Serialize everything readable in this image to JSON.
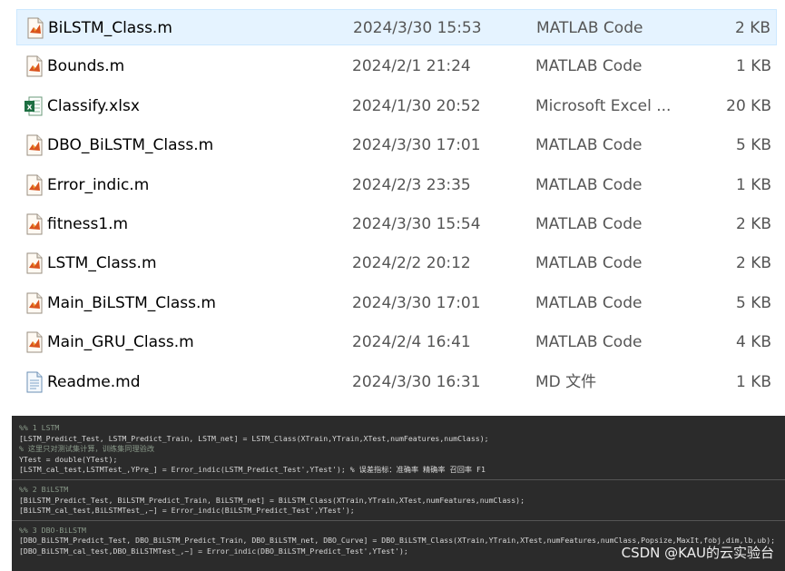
{
  "files": [
    {
      "name": "BiLSTM_Class.m",
      "date": "2024/3/30 15:53",
      "type": "MATLAB Code",
      "size": "2 KB",
      "icon": "matlab-file-icon",
      "selected": true
    },
    {
      "name": "Bounds.m",
      "date": "2024/2/1 21:24",
      "type": "MATLAB Code",
      "size": "1 KB",
      "icon": "matlab-file-icon"
    },
    {
      "name": "Classify.xlsx",
      "date": "2024/1/30 20:52",
      "type": "Microsoft Excel ...",
      "size": "20 KB",
      "icon": "excel-file-icon"
    },
    {
      "name": "DBO_BiLSTM_Class.m",
      "date": "2024/3/30 17:01",
      "type": "MATLAB Code",
      "size": "5 KB",
      "icon": "matlab-file-icon"
    },
    {
      "name": "Error_indic.m",
      "date": "2024/2/3 23:35",
      "type": "MATLAB Code",
      "size": "1 KB",
      "icon": "matlab-file-icon"
    },
    {
      "name": "fitness1.m",
      "date": "2024/3/30 15:54",
      "type": "MATLAB Code",
      "size": "2 KB",
      "icon": "matlab-file-icon"
    },
    {
      "name": "LSTM_Class.m",
      "date": "2024/2/2 20:12",
      "type": "MATLAB Code",
      "size": "2 KB",
      "icon": "matlab-file-icon"
    },
    {
      "name": "Main_BiLSTM_Class.m",
      "date": "2024/3/30 17:01",
      "type": "MATLAB Code",
      "size": "5 KB",
      "icon": "matlab-file-icon"
    },
    {
      "name": "Main_GRU_Class.m",
      "date": "2024/2/4 16:41",
      "type": "MATLAB Code",
      "size": "4 KB",
      "icon": "matlab-file-icon"
    },
    {
      "name": "Readme.md",
      "date": "2024/3/30 16:31",
      "type": "MD 文件",
      "size": "1 KB",
      "icon": "text-file-icon"
    }
  ],
  "code_lines": [
    {
      "text": "%% 1 LSTM",
      "kind": "comment"
    },
    {
      "text": "[LSTM_Predict_Test, LSTM_Predict_Train, LSTM_net] = LSTM_Class(XTrain,YTrain,XTest,numFeatures,numClass);",
      "kind": "code"
    },
    {
      "text": "% 这里只对测试集计算，训练集同理验改",
      "kind": "comment"
    },
    {
      "text": "YTest = double(YTest);",
      "kind": "code"
    },
    {
      "text": "[LSTM_cal_test,LSTMTest_,YPre_] = Error_indic(LSTM_Predict_Test',YTest'); % 误差指标：准确率 精确率 召回率 F1",
      "kind": "code"
    },
    {
      "text": "",
      "kind": "sep"
    },
    {
      "text": "%% 2 BiLSTM",
      "kind": "comment"
    },
    {
      "text": "[BiLSTM_Predict_Test, BiLSTM_Predict_Train, BiLSTM_net] = BiLSTM_Class(XTrain,YTrain,XTest,numFeatures,numClass);",
      "kind": "code"
    },
    {
      "text": "[BiLSTM_cal_test,BiLSTMTest_,~] = Error_indic(BiLSTM_Predict_Test',YTest');",
      "kind": "code"
    },
    {
      "text": "",
      "kind": "sep"
    },
    {
      "text": "%% 3 DBO-BiLSTM",
      "kind": "comment"
    },
    {
      "text": "[DBO_BiLSTM_Predict_Test, DBO_BiLSTM_Predict_Train, DBO_BiLSTM_net, DBO_Curve] = DBO_BiLSTM_Class(XTrain,YTrain,XTest,numFeatures,numClass,Popsize,MaxIt,fobj,dim,lb,ub);",
      "kind": "code"
    },
    {
      "text": "[DBO_BiLSTM_cal_test,DBO_BiLSTMTest_,~] = Error_indic(DBO_BiLSTM_Predict_Test',YTest');",
      "kind": "code"
    }
  ],
  "watermark": "CSDN @KAU的云实验台",
  "colors": {
    "selected_bg": "#e5f3ff",
    "code_bg": "#2b2b2b",
    "matlab_icon": "#d9531e",
    "excel_icon": "#1d6f42"
  }
}
